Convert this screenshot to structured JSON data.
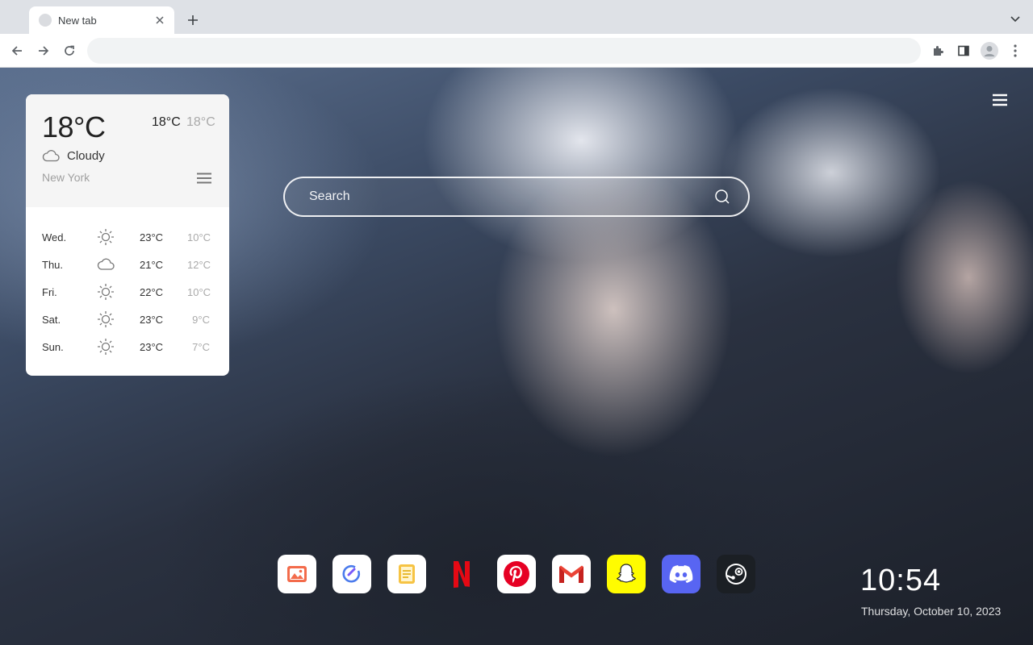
{
  "browser": {
    "tab": {
      "title": "New tab",
      "favicon": "blank-favicon-icon"
    },
    "new_tab_symbol": "+",
    "omnibox": {
      "value": "",
      "placeholder": ""
    }
  },
  "weather": {
    "current_temp": "18°C",
    "high": "18°C",
    "low": "18°C",
    "condition": "Cloudy",
    "condition_icon": "cloud-icon",
    "city": "New York",
    "forecast": [
      {
        "day": "Wed.",
        "icon": "sun-icon",
        "high": "23°C",
        "low": "10°C"
      },
      {
        "day": "Thu.",
        "icon": "cloud-icon",
        "high": "21°C",
        "low": "12°C"
      },
      {
        "day": "Fri.",
        "icon": "sun-icon",
        "high": "22°C",
        "low": "10°C"
      },
      {
        "day": "Sat.",
        "icon": "sun-icon",
        "high": "23°C",
        "low": "9°C"
      },
      {
        "day": "Sun.",
        "icon": "sun-icon",
        "high": "23°C",
        "low": "7°C"
      }
    ]
  },
  "search": {
    "placeholder": "Search"
  },
  "dock": {
    "apps": [
      {
        "name": "photos",
        "color": "#ffffff",
        "accent": "#f36b4b"
      },
      {
        "name": "tasks",
        "color": "#ffffff",
        "accent": "#4b7bec"
      },
      {
        "name": "notes",
        "color": "#ffffff",
        "accent": "#f6c343"
      },
      {
        "name": "netflix",
        "color": "transparent",
        "accent": "#e50914"
      },
      {
        "name": "pinterest",
        "color": "#ffffff",
        "accent": "#e60023"
      },
      {
        "name": "gmail",
        "color": "#ffffff",
        "accent": "#ea4335"
      },
      {
        "name": "snapchat",
        "color": "#fffc00",
        "accent": "#ffffff"
      },
      {
        "name": "discord",
        "color": "#5865f2",
        "accent": "#ffffff"
      },
      {
        "name": "steam",
        "color": "#1b1f24",
        "accent": "#ffffff"
      }
    ]
  },
  "clock": {
    "time": "10:54",
    "date": "Thursday, October 10, 2023"
  }
}
